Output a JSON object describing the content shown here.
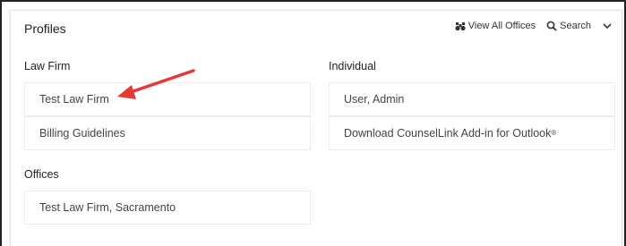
{
  "header": {
    "title": "Profiles",
    "view_all_offices_label": "View All Offices",
    "search_label": "Search"
  },
  "law_firm": {
    "heading": "Law Firm",
    "items": [
      {
        "label": "Test Law Firm"
      },
      {
        "label": "Billing Guidelines"
      }
    ]
  },
  "individual": {
    "heading": "Individual",
    "items": [
      {
        "label": "User, Admin"
      },
      {
        "label": "Download CounselLink Add-in for Outlook",
        "superscript": "®"
      }
    ]
  },
  "offices": {
    "heading": "Offices",
    "items": [
      {
        "label": "Test Law Firm, Sacramento"
      }
    ]
  },
  "colors": {
    "annotation_arrow": "#e53935",
    "frame": "#222222",
    "tile_border": "#ececec"
  },
  "icons": {
    "view_all_offices": "binoculars-icon",
    "search": "search-icon",
    "collapse": "chevron-down-icon"
  }
}
